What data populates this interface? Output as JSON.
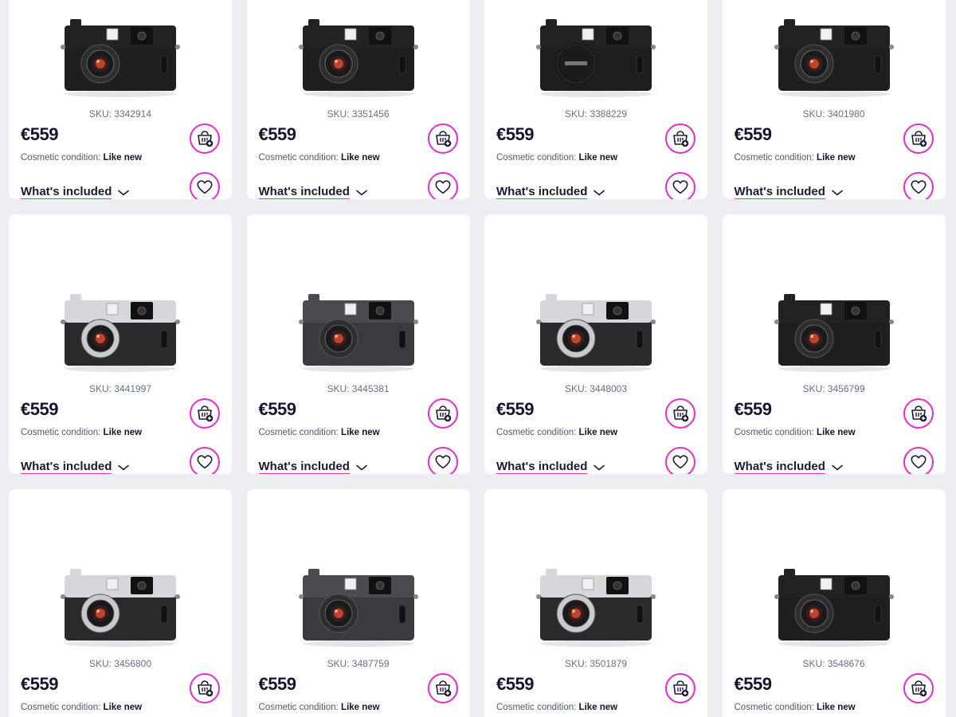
{
  "colors": {
    "accent": "#e52ec6",
    "background": "#eceef2",
    "card": "#ffffff",
    "text": "#16152e"
  },
  "icons": {
    "basket": "add-to-basket-icon",
    "wishlist": "heart-icon",
    "expand": "chevron-down-icon"
  },
  "labels": {
    "sku_prefix": "SKU: ",
    "condition_prefix": "Cosmetic condition: ",
    "whats_included": "What's included"
  },
  "products": [
    {
      "sku": "SKU: 3342914",
      "price": "€559",
      "condition": "Like new",
      "body": "black"
    },
    {
      "sku": "SKU: 3351456",
      "price": "€559",
      "condition": "Like new",
      "body": "black"
    },
    {
      "sku": "SKU: 3388229",
      "price": "€559",
      "condition": "Like new",
      "body": "black-cap"
    },
    {
      "sku": "SKU: 3401980",
      "price": "€559",
      "condition": "Like new",
      "body": "black"
    },
    {
      "sku": "SKU: 3441997",
      "price": "€559",
      "condition": "Like new",
      "body": "silver"
    },
    {
      "sku": "SKU: 3445381",
      "price": "€559",
      "condition": "Like new",
      "body": "charcoal"
    },
    {
      "sku": "SKU: 3448003",
      "price": "€559",
      "condition": "Like new",
      "body": "silver"
    },
    {
      "sku": "SKU: 3456799",
      "price": "€559",
      "condition": "Like new",
      "body": "black"
    },
    {
      "sku": "SKU: 3456800",
      "price": "€559",
      "condition": "Like new",
      "body": "silver"
    },
    {
      "sku": "SKU: 3487759",
      "price": "€559",
      "condition": "Like new",
      "body": "charcoal"
    },
    {
      "sku": "SKU: 3501879",
      "price": "€559",
      "condition": "Like new",
      "body": "silver"
    },
    {
      "sku": "SKU: 3548676",
      "price": "€559",
      "condition": "Like new",
      "body": "black"
    }
  ]
}
